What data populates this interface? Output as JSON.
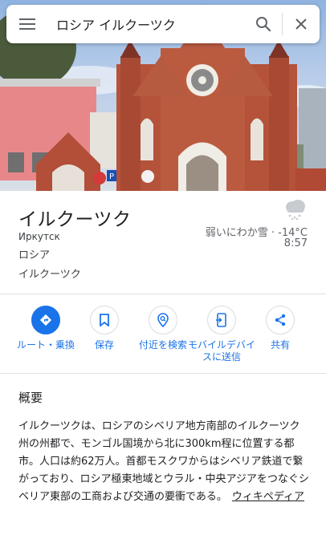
{
  "search": {
    "query": "ロシア イルクーツク"
  },
  "icons": {
    "menu": "hamburger-menu-icon",
    "search": "search-icon",
    "close": "close-icon",
    "weather": "snow-cloud-icon",
    "directions": "directions-icon",
    "save": "bookmark-icon",
    "nearby": "nearby-search-icon",
    "send_to_device": "send-to-device-icon",
    "share": "share-icon"
  },
  "place": {
    "title": "イルクーツク",
    "native_name": "Иркутск",
    "country": "ロシア",
    "locality": "イルクーツク"
  },
  "weather": {
    "condition_temp": "弱いにわか雪 · -14°C",
    "time": "8:57"
  },
  "actions": [
    {
      "label": "ルート・乗換"
    },
    {
      "label": "保存"
    },
    {
      "label": "付近を検索"
    },
    {
      "label": "モバイルデバイスに送信"
    },
    {
      "label": "共有"
    }
  ],
  "overview": {
    "title": "概要",
    "text": "イルクーツクは、ロシアのシベリア地方南部のイルクーツク州の州都で、モンゴル国境から北に300km程に位置する都市。人口は約62万人。首都モスクワからはシベリア鉄道で繋がっており、ロシア極東地域とウラル・中央アジアをつなぐシベリア東部の工商および交通の要衝である。",
    "link": "ウィキペディア"
  },
  "colors": {
    "accent": "#1a73e8",
    "brick": "#b4523a",
    "text_primary": "#202124",
    "text_secondary": "#5f6368"
  }
}
